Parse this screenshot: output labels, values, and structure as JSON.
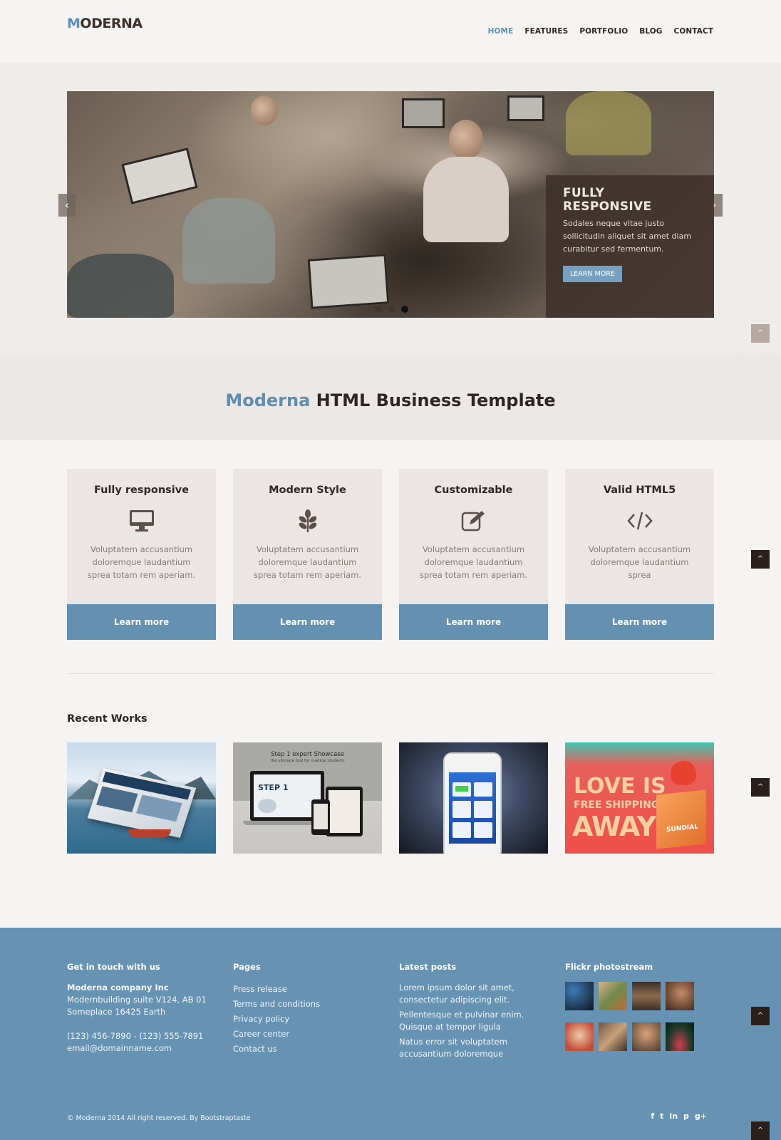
{
  "header": {
    "logo_accent": "M",
    "logo_rest": "ODERNA",
    "nav": [
      "HOME",
      "FEATURES",
      "PORTFOLIO",
      "BLOG",
      "CONTACT"
    ]
  },
  "slider": {
    "caption_title": "FULLY RESPONSIVE",
    "caption_text": "Sodales neque vitae justo sollicitudin aliquet sit amet diam curabitur sed fermentum.",
    "caption_button": "LEARN MORE",
    "prev_icon": "‹",
    "next_icon": "›",
    "slides_count": 3,
    "active_slide": 3
  },
  "tagline": {
    "accent": "Moderna",
    "rest": " HTML Business Template"
  },
  "features": [
    {
      "title": "Fully responsive",
      "icon": "desktop-icon",
      "text": "Voluptatem accusantium doloremque laudantium sprea totam rem aperiam.",
      "button": "Learn more"
    },
    {
      "title": "Modern Style",
      "icon": "leaf-icon",
      "text": "Voluptatem accusantium doloremque laudantium sprea totam rem aperiam.",
      "button": "Learn more"
    },
    {
      "title": "Customizable",
      "icon": "edit-icon",
      "text": "Voluptatem accusantium doloremque laudantium sprea totam rem aperiam.",
      "button": "Learn more"
    },
    {
      "title": "Valid HTML5",
      "icon": "code-icon",
      "text": "Voluptatem accusantium doloremque laudantium sprea",
      "button": "Learn more"
    }
  ],
  "recent_works": {
    "title": "Recent Works",
    "items": [
      {
        "name": "website-mockup-lake"
      },
      {
        "name": "step1-expert-showcase",
        "heading": "Step 1 expert Showcase",
        "sub": "the ultimate tool for medical students",
        "logo": "STEP 1"
      },
      {
        "name": "iphone-app"
      },
      {
        "name": "love-is-free-shipping",
        "line1": "LOVE IS",
        "line2": "FREE SHIPPING",
        "line3": "AWAY",
        "brand": "SUNDIAL"
      }
    ]
  },
  "footer": {
    "contact": {
      "title": "Get in touch with us",
      "company": "Moderna company Inc",
      "address1": "Modernbuilding suite V124, AB 01",
      "address2": "Someplace 16425 Earth",
      "phone": "(123) 456-7890 - (123) 555-7891",
      "email": "email@domainname.com"
    },
    "pages": {
      "title": "Pages",
      "links": [
        "Press release",
        "Terms and conditions",
        "Privacy policy",
        "Career center",
        "Contact us"
      ]
    },
    "posts": {
      "title": "Latest posts",
      "items": [
        "Lorem ipsum dolor sit amet, consectetur adipiscing elit.",
        "Pellentesque et pulvinar enim. Quisque at tempor ligula",
        "Natus error sit voluptatem accusantium doloremque"
      ]
    },
    "flickr": {
      "title": "Flickr photostream",
      "thumb_colors": [
        "#1b2733",
        "#b48a5c",
        "#6c5a48",
        "#4a3426",
        "#d4a98a",
        "#5b4a3c",
        "#8f6d4e",
        "#2f4a38"
      ]
    },
    "copyright": "© Moderna 2014 All right reserved. By Bootstraptaste",
    "social": [
      "f",
      "t",
      "in",
      "p",
      "g+"
    ]
  },
  "colors": {
    "accent": "#5e8eb1",
    "button": "#6490b2",
    "footer_bg": "#6693b4",
    "dark_text": "#2e2623"
  }
}
